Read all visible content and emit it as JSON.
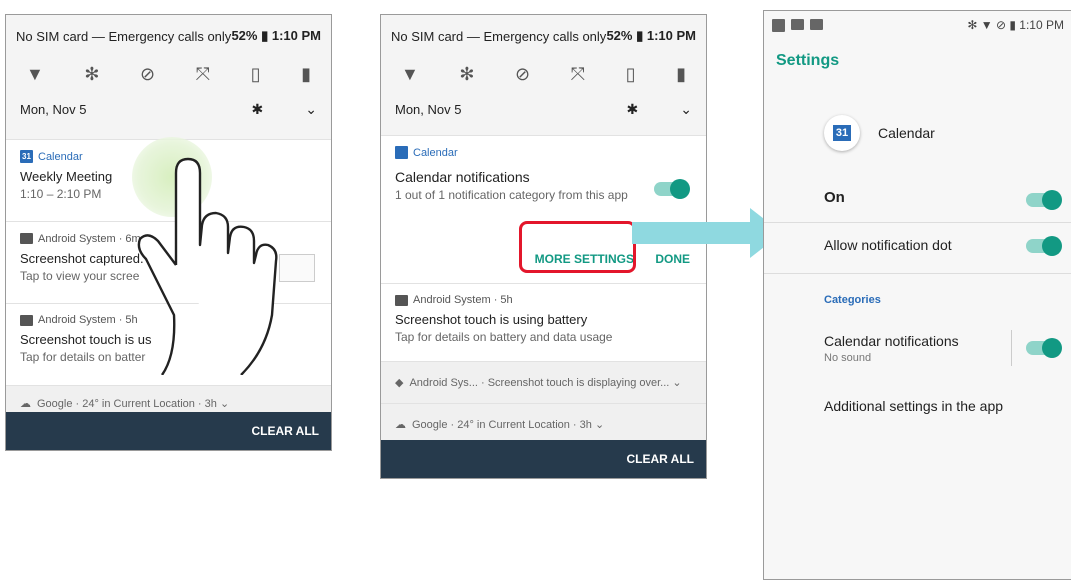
{
  "status": {
    "left": "No SIM card — Emergency calls only",
    "battery": "52%",
    "time": "1:10 PM"
  },
  "date": "Mon, Nov 5",
  "phone1": {
    "cal_app": "Calendar",
    "cal_title": "Weekly Meeting",
    "cal_time": "1:10 – 2:10 PM",
    "sys1_app": "Android System · 6m ⌄",
    "sys1_title": "Screenshot captured.",
    "sys1_text": "Tap to view your scree",
    "sys2_app": "Android System · 5h",
    "sys2_title": "Screenshot touch is us",
    "sys2_text": "Tap for details on batter",
    "google": "Google · 24° in Current Location · 3h ⌄",
    "clear": "CLEAR ALL"
  },
  "phone2": {
    "cal_app": "Calendar",
    "notif_title": "Calendar notifications",
    "notif_sub": "1 out of 1 notification category from this app",
    "more": "MORE SETTINGS",
    "done": "DONE",
    "sys_app": "Android System · 5h",
    "sys_title": "Screenshot touch is using battery",
    "sys_text": "Tap for details on battery and data usage",
    "sys_row": "Android Sys... · Screenshot touch is displaying over... ⌄",
    "google": "Google · 24° in Current Location · 3h ⌄",
    "clear": "CLEAR ALL"
  },
  "phone3": {
    "time": "1:10 PM",
    "title": "Settings",
    "app_name": "Calendar",
    "app_icon_num": "31",
    "on": "On",
    "dot": "Allow notification dot",
    "categories": "Categories",
    "cat_title": "Calendar notifications",
    "cat_sub": "No sound",
    "additional": "Additional settings in the app"
  },
  "colors": {
    "accent": "#129983",
    "highlight": "#e3162b",
    "arrow": "#8fd9e0",
    "footer": "#263a4c"
  }
}
